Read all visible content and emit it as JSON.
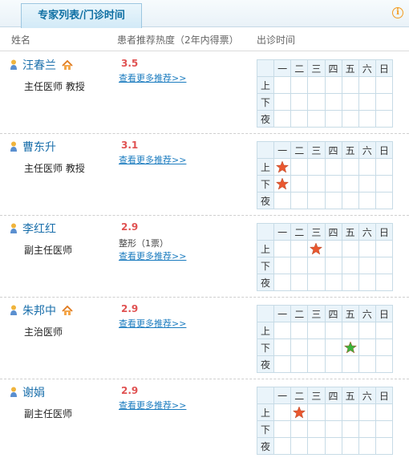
{
  "header": {
    "tab_label": "专家列表/门诊时间",
    "info_icon": "info-circle-icon"
  },
  "columns": {
    "name": "姓名",
    "rating": "患者推荐热度（2年内得票）",
    "schedule": "出诊时间"
  },
  "schedule_days": [
    "一",
    "二",
    "三",
    "四",
    "五",
    "六",
    "日"
  ],
  "schedule_periods": [
    "上",
    "下",
    "夜"
  ],
  "colors": {
    "link": "#1a7bbf",
    "score": "#e05252",
    "star_red": "#e9572f",
    "star_green": "#3cb43c",
    "tab_text": "#0e6fa3"
  },
  "doctors": [
    {
      "name": "汪春兰",
      "title": "主任医师 教授",
      "score": "3.5",
      "more_link": "查看更多推荐>>",
      "has_home_icon": true,
      "extra": "",
      "schedule": []
    },
    {
      "name": "曹东升",
      "title": "主任医师 教授",
      "score": "3.1",
      "more_link": "查看更多推荐>>",
      "has_home_icon": false,
      "extra": "",
      "schedule": [
        {
          "period": "上",
          "day": "一",
          "color": "red"
        },
        {
          "period": "下",
          "day": "一",
          "color": "red"
        }
      ]
    },
    {
      "name": "李红红",
      "title": "副主任医师",
      "score": "2.9",
      "more_link": "查看更多推荐>>",
      "has_home_icon": false,
      "extra": "整形（1票）",
      "schedule": [
        {
          "period": "上",
          "day": "三",
          "color": "red"
        }
      ]
    },
    {
      "name": "朱邦中",
      "title": "主治医师",
      "score": "2.9",
      "more_link": "查看更多推荐>>",
      "has_home_icon": true,
      "extra": "",
      "schedule": [
        {
          "period": "下",
          "day": "五",
          "color": "green"
        }
      ]
    },
    {
      "name": "谢娟",
      "title": "副主任医师",
      "score": "2.9",
      "more_link": "查看更多推荐>>",
      "has_home_icon": false,
      "extra": "",
      "schedule": [
        {
          "period": "上",
          "day": "二",
          "color": "red"
        }
      ]
    }
  ]
}
